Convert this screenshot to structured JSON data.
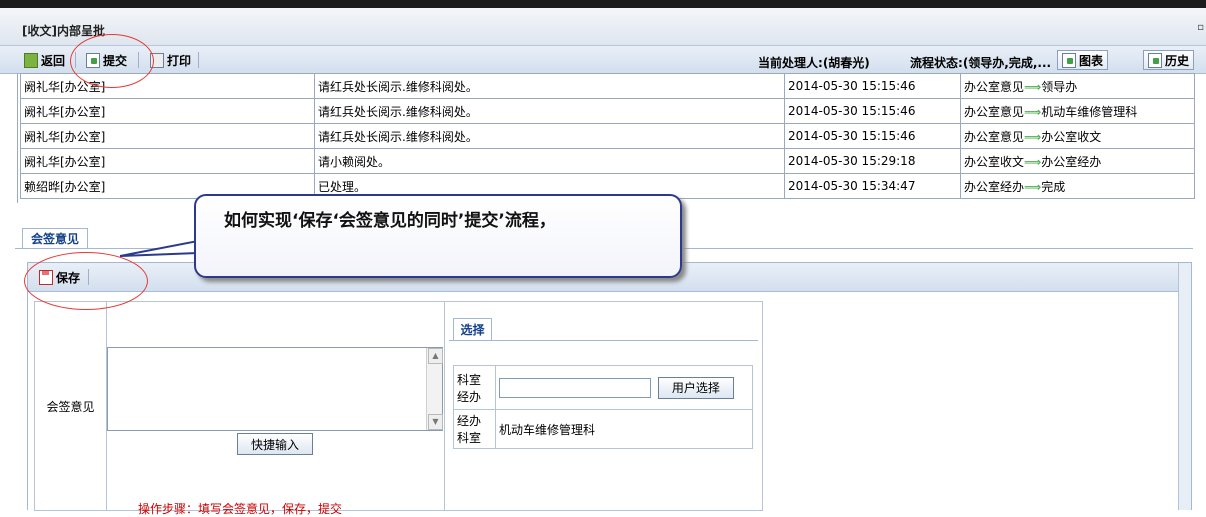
{
  "window": {
    "title": "[收文]内部呈批"
  },
  "toolbar": {
    "back": "返回",
    "submit": "提交",
    "print": "打印",
    "handler_label": "当前处理人:",
    "handler_value": "(胡春光)",
    "status_label": "流程状态:",
    "status_value": "(领导办,完成,...",
    "chart_btn": "图表",
    "history_btn": "历史"
  },
  "history": {
    "rows": [
      {
        "user": "阙礼华[办公室]",
        "opinion": "请红兵处长阅示.维修科阅处。",
        "time": "2014-05-30 15:15:46",
        "from": "办公室意见",
        "to": "领导办"
      },
      {
        "user": "阙礼华[办公室]",
        "opinion": "请红兵处长阅示.维修科阅处。",
        "time": "2014-05-30 15:15:46",
        "from": "办公室意见",
        "to": "机动车维修管理科"
      },
      {
        "user": "阙礼华[办公室]",
        "opinion": "请红兵处长阅示.维修科阅处。",
        "time": "2014-05-30 15:15:46",
        "from": "办公室意见",
        "to": "办公室收文"
      },
      {
        "user": "阙礼华[办公室]",
        "opinion": "请小赖阅处。",
        "time": "2014-05-30 15:29:18",
        "from": "办公室收文",
        "to": "办公室经办"
      },
      {
        "user": "赖绍晔[办公室]",
        "opinion": "已处理。",
        "time": "2014-05-30 15:34:47",
        "from": "办公室经办",
        "to": "完成"
      }
    ]
  },
  "tabs": {
    "countersign": "会签意见"
  },
  "panel": {
    "save": "保存"
  },
  "form": {
    "label": "会签意见",
    "quick_input": "快捷输入",
    "select_tab": "选择",
    "office_handler_label": "科室经办",
    "user_select_button": "用户选择",
    "dept_label": "经办科室",
    "dept_value": "机动车维修管理科"
  },
  "callout": {
    "text": "如何实现‘保存‘会签意见的同时’提交’流程，"
  },
  "footnote": "操作步骤：填写会签意见，保存，提交"
}
